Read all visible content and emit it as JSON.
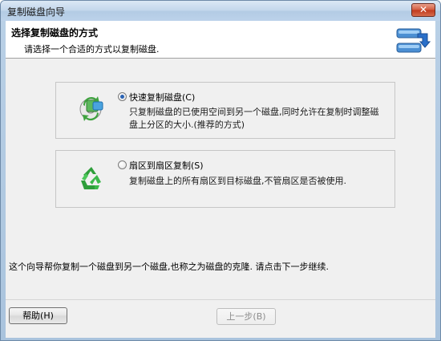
{
  "window": {
    "title": "复制磁盘向导",
    "close_label": "✕"
  },
  "header": {
    "title": "选择复制磁盘的方式",
    "subtitle": "请选择一个合适的方式以复制磁盘."
  },
  "options": [
    {
      "label": "快速复制磁盘(C)",
      "selected": true,
      "description": "只复制磁盘的已使用空间到另一个磁盘,同时允许在复制时调整磁盘上分区的大小.(推荐的方式)",
      "icon": "disk-copy-icon"
    },
    {
      "label": "扇区到扇区复制(S)",
      "selected": false,
      "description": "复制磁盘上的所有扇区到目标磁盘,不管扇区是否被使用.",
      "icon": "recycle-icon"
    }
  ],
  "info_text": "这个向导帮你复制一个磁盘到另一个磁盘,也称之为磁盘的克隆. 请点击下一步继续.",
  "footer": {
    "help_label": "帮助(H)",
    "prev_label": "上一步(B)"
  },
  "colors": {
    "radio_selected": "#2a62b3",
    "titlebar": "#c2d6eb",
    "close": "#c0391d"
  }
}
